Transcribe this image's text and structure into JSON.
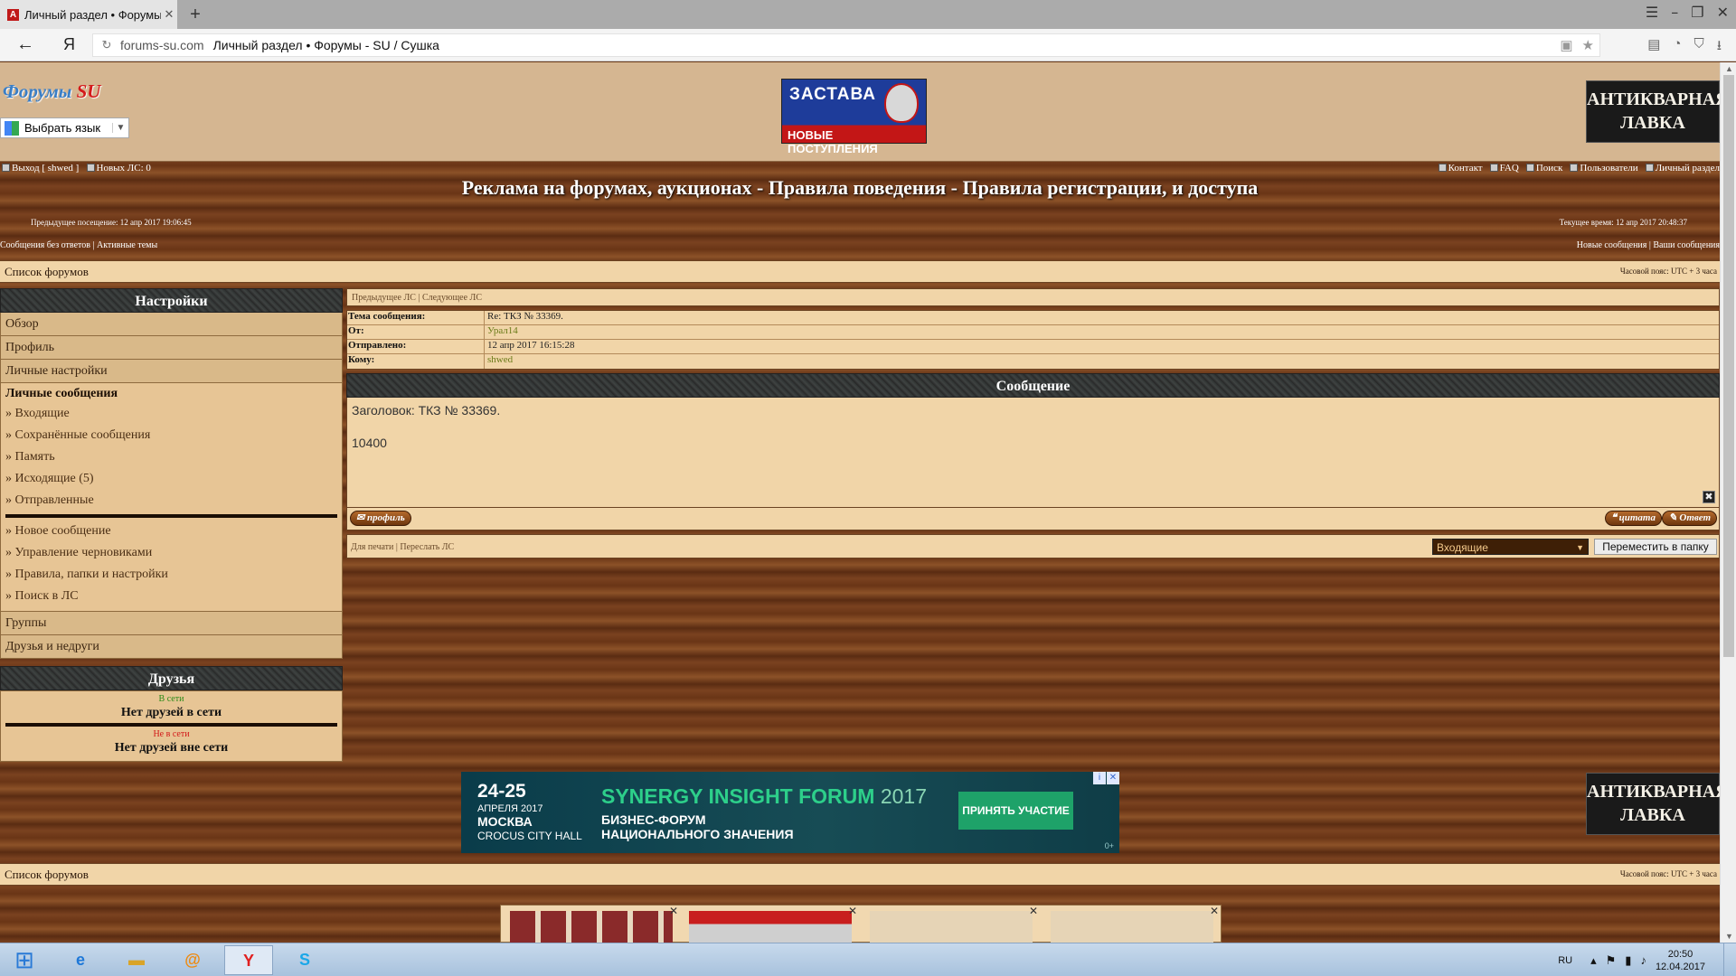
{
  "browser": {
    "tab_title": "Личный раздел • Форумы - SU / Сушка",
    "tab_icon": "opera-a-icon",
    "new_tab": "+",
    "yandex_label": "Я",
    "url_domain": "forums-su.com",
    "url_title": "Личный раздел • Форумы - SU / Сушка"
  },
  "header": {
    "logo_main": "Форумы",
    "logo_su": "SU",
    "lang_select": "Выбрать язык",
    "banner_left": {
      "line1": "ЗАСТАВА",
      "line2": "НОВЫЕ ПОСТУПЛЕНИЯ"
    },
    "banner_right": {
      "line1": "АНТИКВАРНАЯ",
      "line2": "ЛАВКА"
    }
  },
  "topnav": {
    "logout": "Выход [ shwed ]",
    "new_pm": "Новых ЛС: 0",
    "links": [
      "Контакт",
      "FAQ",
      "Поиск",
      "Пользователи",
      "Личный раздел"
    ]
  },
  "main_heading": "Реклама на форумах, аукционах - Правила поведения - Правила регистрации, и доступа",
  "visits": {
    "previous": "Предыдущее посещение: 12 апр 2017 19:06:45",
    "current": "Текущее время: 12 апр 2017 20:48:37"
  },
  "quicklinks": {
    "left": "Сообщения без ответов | Активные темы",
    "right": "Новые сообщения | Ваши сообщения"
  },
  "forum_bar": {
    "label": "Список форумов",
    "timezone": "Часовой пояс: UTC + 3 часа"
  },
  "sidebar": {
    "settings_title": "Настройки",
    "items": [
      "Обзор",
      "Профиль",
      "Личные настройки"
    ],
    "pm_title": "Личные сообщения",
    "pm_items": [
      "» Входящие",
      "» Сохранённые сообщения",
      "» Память",
      "» Исходящие (5)",
      "» Отправленные"
    ],
    "pm_items2": [
      "» Новое сообщение",
      "» Управление черновиками",
      "» Правила, папки и настройки",
      "» Поиск в ЛС"
    ],
    "groups": "Группы",
    "friends_foes": "Друзья и недруги",
    "friends_title": "Друзья",
    "online_label": "В сети",
    "no_online": "Нет друзей в сети",
    "offline_label": "Не в сети",
    "no_offline": "Нет друзей вне сети"
  },
  "message": {
    "prev_next": "Предыдущее ЛС | Следующее ЛС",
    "subject_label": "Тема сообщения:",
    "subject": "Re: ТКЗ № 33369.",
    "from_label": "От:",
    "from": "Урал14",
    "sent_label": "Отправлено:",
    "sent": "12 апр 2017 16:15:28",
    "to_label": "Кому:",
    "to": "shwed",
    "header": "Сообщение",
    "body_subject": "Заголовок: ТКЗ № 33369.",
    "body_text": "10400",
    "close_glyph": "✖",
    "profile_btn": "профиль",
    "quote_btn": "цитата",
    "reply_btn": "Ответ"
  },
  "actions": {
    "left": "Для печати | Переслать ЛС",
    "folder": "Входящие",
    "move_btn": "Переместить в папку"
  },
  "ad": {
    "dates": "24-25",
    "month": "АПРЕЛЯ 2017",
    "city": "МОСКВА",
    "hall": "CROCUS CITY HALL",
    "brand": "SYNERGY INSIGHT FORUM",
    "year": "2017",
    "line1": "БИЗНЕС-ФОРУМ",
    "line2": "НАЦИОНАЛЬНОГО ЗНАЧЕНИЯ",
    "cta": "ПРИНЯТЬ УЧАСТИЕ",
    "counter": "0+"
  },
  "forum_bar_bottom": {
    "label": "Список форумов",
    "timezone": "Часовой пояс: UTC + 3 часа"
  },
  "taskbar": {
    "lang": "RU",
    "time": "20:50",
    "date": "12.04.2017"
  }
}
